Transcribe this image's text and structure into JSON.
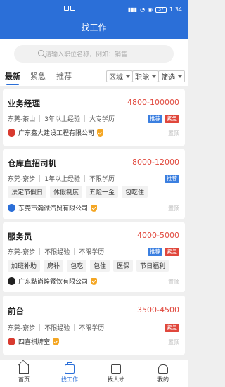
{
  "status_bar": {
    "time": "1:34",
    "battery": "37"
  },
  "header": {
    "title": "找工作"
  },
  "search": {
    "placeholder": "请输入职位名称，例如：销售"
  },
  "tabs": [
    {
      "label": "最新",
      "active": true
    },
    {
      "label": "紧急",
      "active": false
    },
    {
      "label": "推荐",
      "active": false
    }
  ],
  "filters": [
    {
      "label": "区域"
    },
    {
      "label": "职能"
    },
    {
      "label": "筛选"
    }
  ],
  "jobs": [
    {
      "title": "业务经理",
      "salary": "4800-100000",
      "location": "东莞-茶山",
      "experience": "3年以上经验",
      "education": "大专学历",
      "badges": [
        "推荐",
        "紧急"
      ],
      "benefits": [],
      "company": "广东鑫大建设工程有限公司",
      "pin": "置顶"
    },
    {
      "title": "仓库直招司机",
      "salary": "8000-12000",
      "location": "东莞-寮步",
      "experience": "1年以上经验",
      "education": "不限学历",
      "badges": [
        "推荐"
      ],
      "benefits": [
        "法定节假日",
        "休假制度",
        "五险一金",
        "包吃住"
      ],
      "company": "东莞市瀚诚汽贸有限公司",
      "pin": "置顶"
    },
    {
      "title": "服务员",
      "salary": "4000-5000",
      "location": "东莞-寮步",
      "experience": "不限经验",
      "education": "不限学历",
      "badges": [
        "推荐",
        "紧急"
      ],
      "benefits": [
        "加班补助",
        "房补",
        "包吃",
        "包住",
        "医保",
        "节日福利"
      ],
      "company": "广东黠尚煌餐饮有限公司",
      "pin": "置顶"
    },
    {
      "title": "前台",
      "salary": "3500-4500",
      "location": "东莞-寮步",
      "experience": "不限经验",
      "education": "不限学历",
      "badges": [
        "紧急"
      ],
      "benefits": [],
      "company": "四喜棋牌室",
      "pin": "置顶"
    }
  ],
  "bottom_nav": [
    {
      "label": "首页",
      "icon": "home-icon",
      "active": false
    },
    {
      "label": "找工作",
      "icon": "briefcase-icon",
      "active": true
    },
    {
      "label": "找人才",
      "icon": "talent-icon",
      "active": false
    },
    {
      "label": "我的",
      "icon": "user-icon",
      "active": false
    }
  ],
  "colors": {
    "primary": "#2b6fd8",
    "salary": "#e0473c",
    "badge_recommend": "#3b7fe0",
    "badge_urgent": "#e0473c"
  }
}
